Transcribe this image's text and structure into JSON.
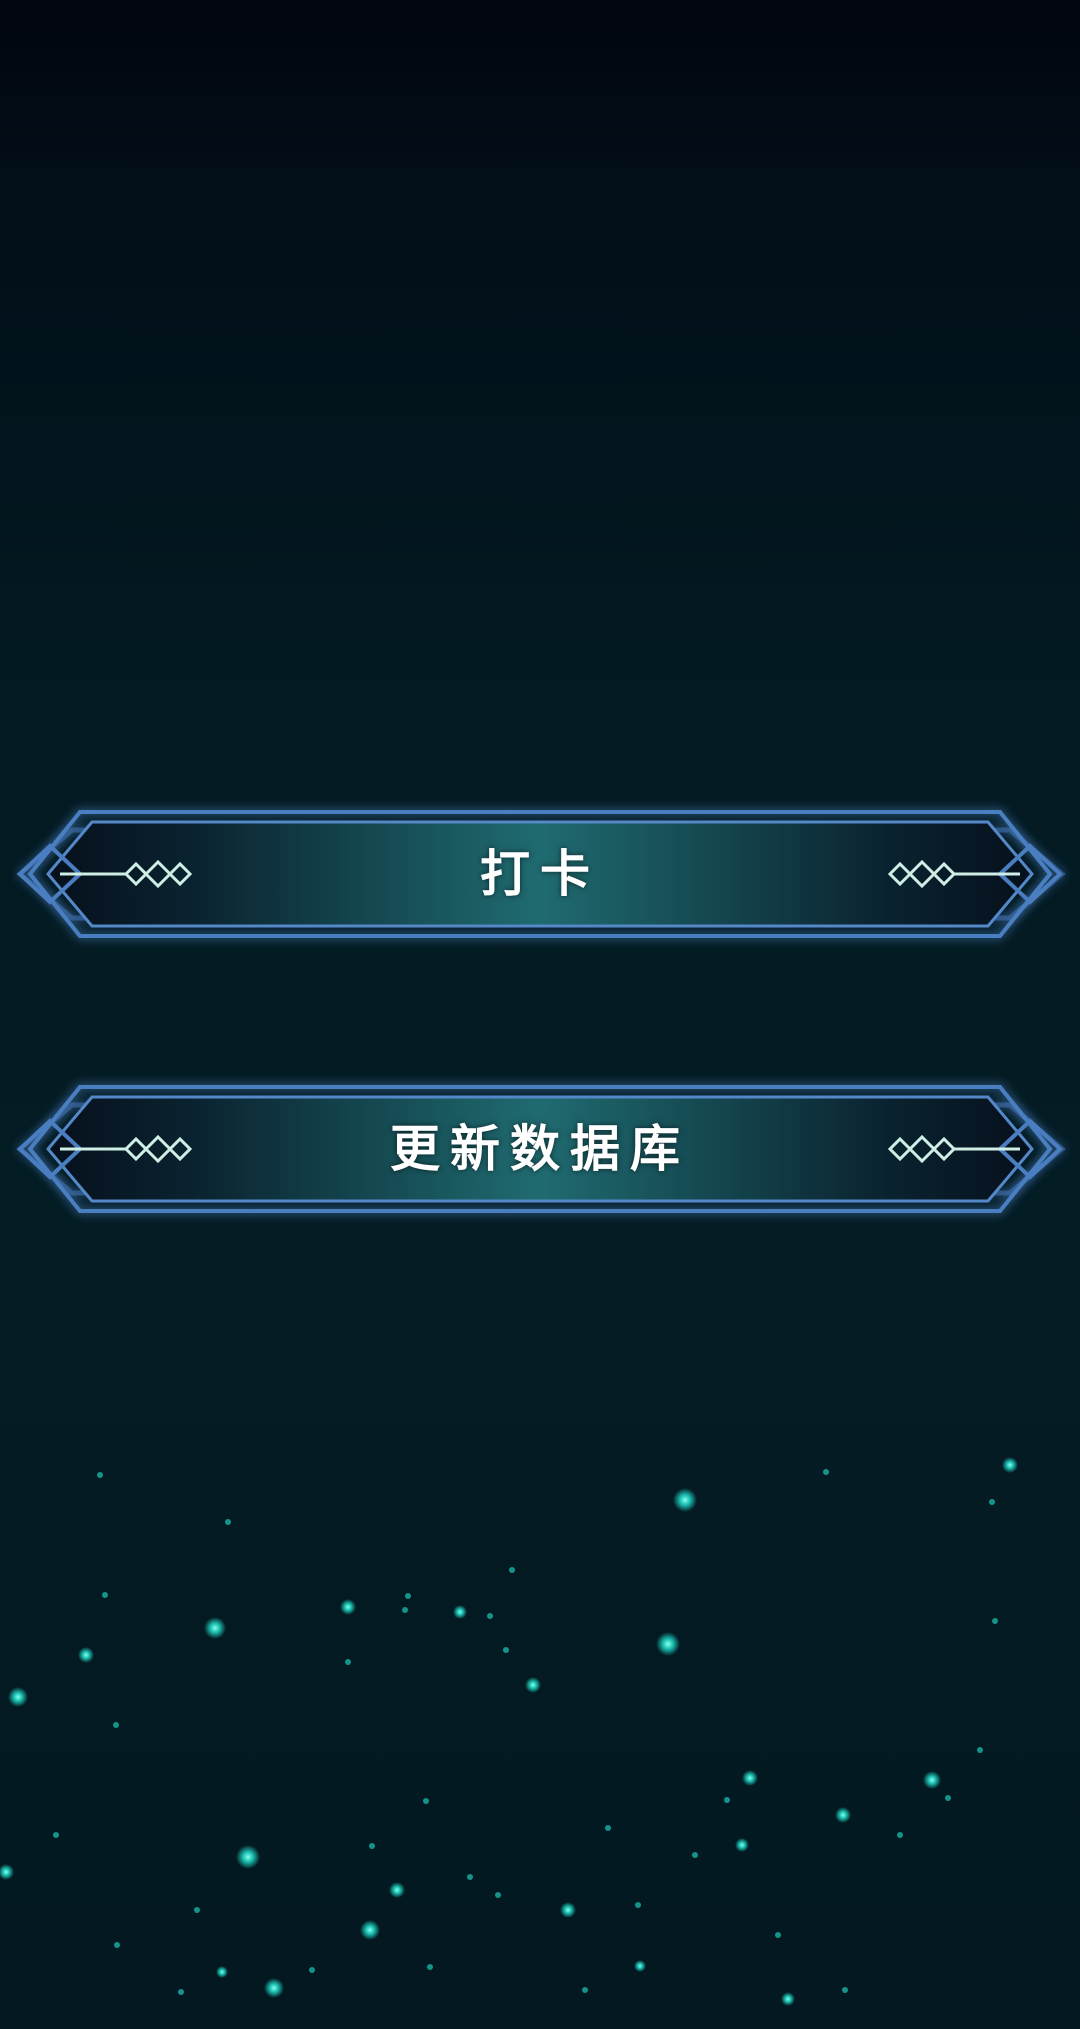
{
  "theme": {
    "background_top": "#01050d",
    "background_bottom": "#031820",
    "frame_border": "#3f6fb0",
    "button_center": "#1f6b70",
    "button_edge": "#081626",
    "ornament": "#cfeee6",
    "particle": "#1fd6c4"
  },
  "menu": {
    "items": [
      {
        "label": "打卡",
        "icon_left": "diamond-ornament-icon",
        "icon_right": "diamond-ornament-icon"
      },
      {
        "label": "更新数据库",
        "icon_left": "diamond-ornament-icon",
        "icon_right": "diamond-ornament-icon"
      }
    ]
  }
}
